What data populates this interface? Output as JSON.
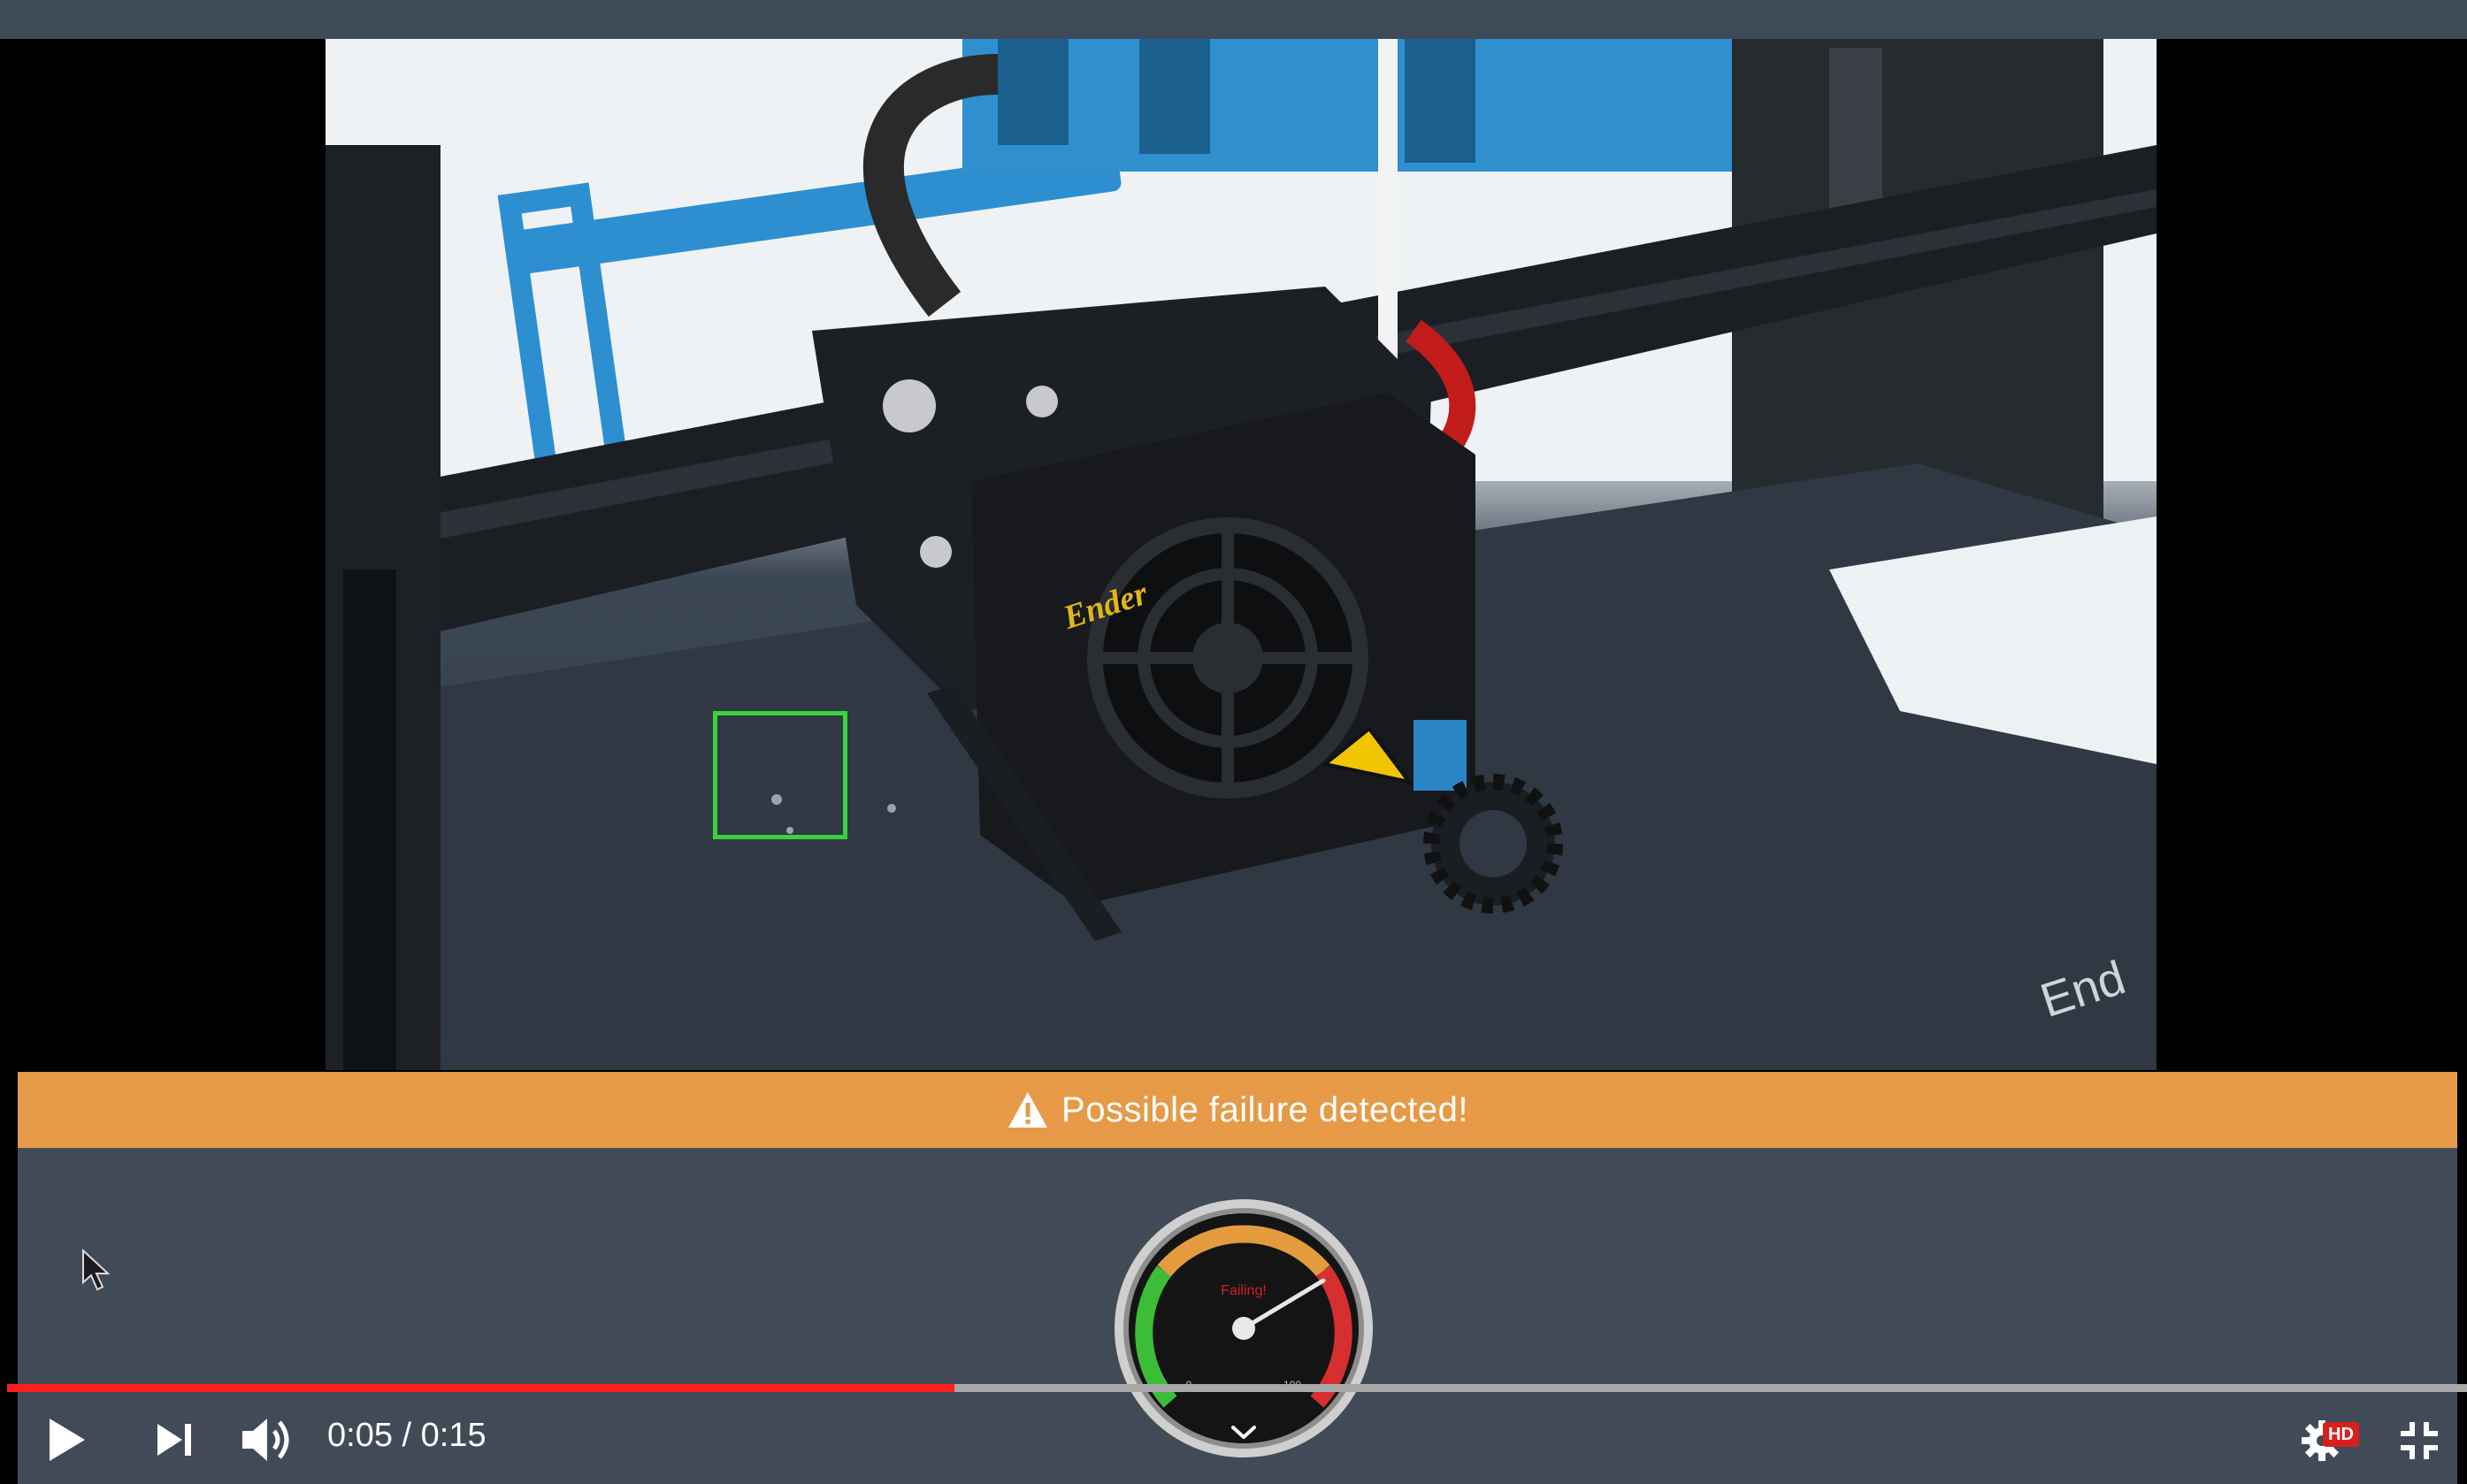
{
  "player": {
    "alert_text": "Possible failure detected!",
    "time_current": "0:05",
    "time_separator": "/",
    "time_total": "0:15",
    "progress": 0.385,
    "quality_badge": "HD"
  },
  "gauge": {
    "status_label": "Failing!",
    "min_label": "0",
    "max_label": "100"
  },
  "feed": {
    "printer_brand_text": "Ender",
    "bed_text": "End"
  },
  "colors": {
    "alert": "#e69a47",
    "progress_played": "#ff1e1e",
    "detection_box": "#39d33a",
    "panel": "#414b58"
  },
  "icons": {
    "alert": "warning-triangle-icon",
    "play": "play-icon",
    "next": "skip-next-icon",
    "volume": "volume-icon",
    "settings": "gear-icon",
    "exit_fullscreen": "exit-fullscreen-icon",
    "gauge_toggle": "chevron-down-icon"
  }
}
